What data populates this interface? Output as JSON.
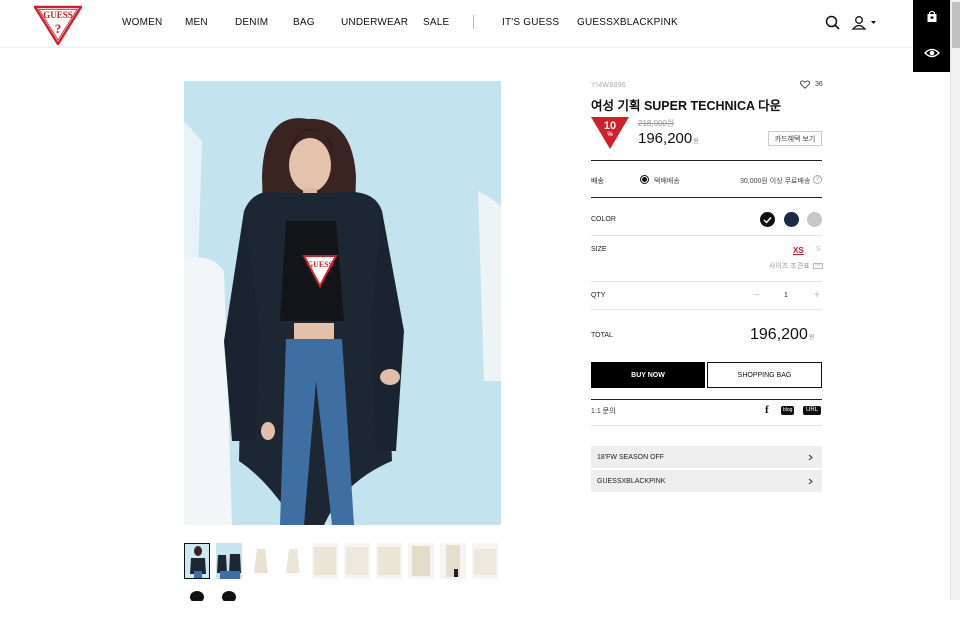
{
  "nav": {
    "items": [
      "WOMEN",
      "MEN",
      "DENIM",
      "BAG",
      "UNDERWEAR",
      "SALE",
      "IT'S GUESS",
      "GUESSXBLACKPINK"
    ]
  },
  "product": {
    "code": "YI4W8896",
    "likes": "36",
    "name": "여성 기획 SUPER TECHNICA 다운",
    "discount": "10",
    "discount_symbol": "%",
    "original_price": "218,000원",
    "price": "196,200",
    "price_unit": "원",
    "card_benefit": "카드혜택 보기"
  },
  "shipping": {
    "label": "배송",
    "method": "택배배송",
    "note": "30,000원 이상 무료배송",
    "help": "?"
  },
  "color": {
    "label": "COLOR",
    "swatches": [
      "#111111",
      "#1e2a44",
      "#c7c7c7"
    ]
  },
  "size": {
    "label": "SIZE",
    "options": [
      "XS",
      "S"
    ],
    "guide": "사이즈 조견표"
  },
  "qty": {
    "label": "QTY",
    "minus": "−",
    "value": "1",
    "plus": "+"
  },
  "total": {
    "label": "TOTAL",
    "value": "196,200",
    "unit": "원"
  },
  "buttons": {
    "buy": "BUY NOW",
    "bag": "SHOPPING BAG"
  },
  "inquiry": "1:1 문의",
  "share": {
    "facebook": "f",
    "blog": "blog",
    "url": "URL"
  },
  "promos": [
    "18'FW SEASON OFF",
    "GUESSXBLACKPINK"
  ],
  "colors": {
    "accent": "#d1202b",
    "black": "#000000"
  }
}
